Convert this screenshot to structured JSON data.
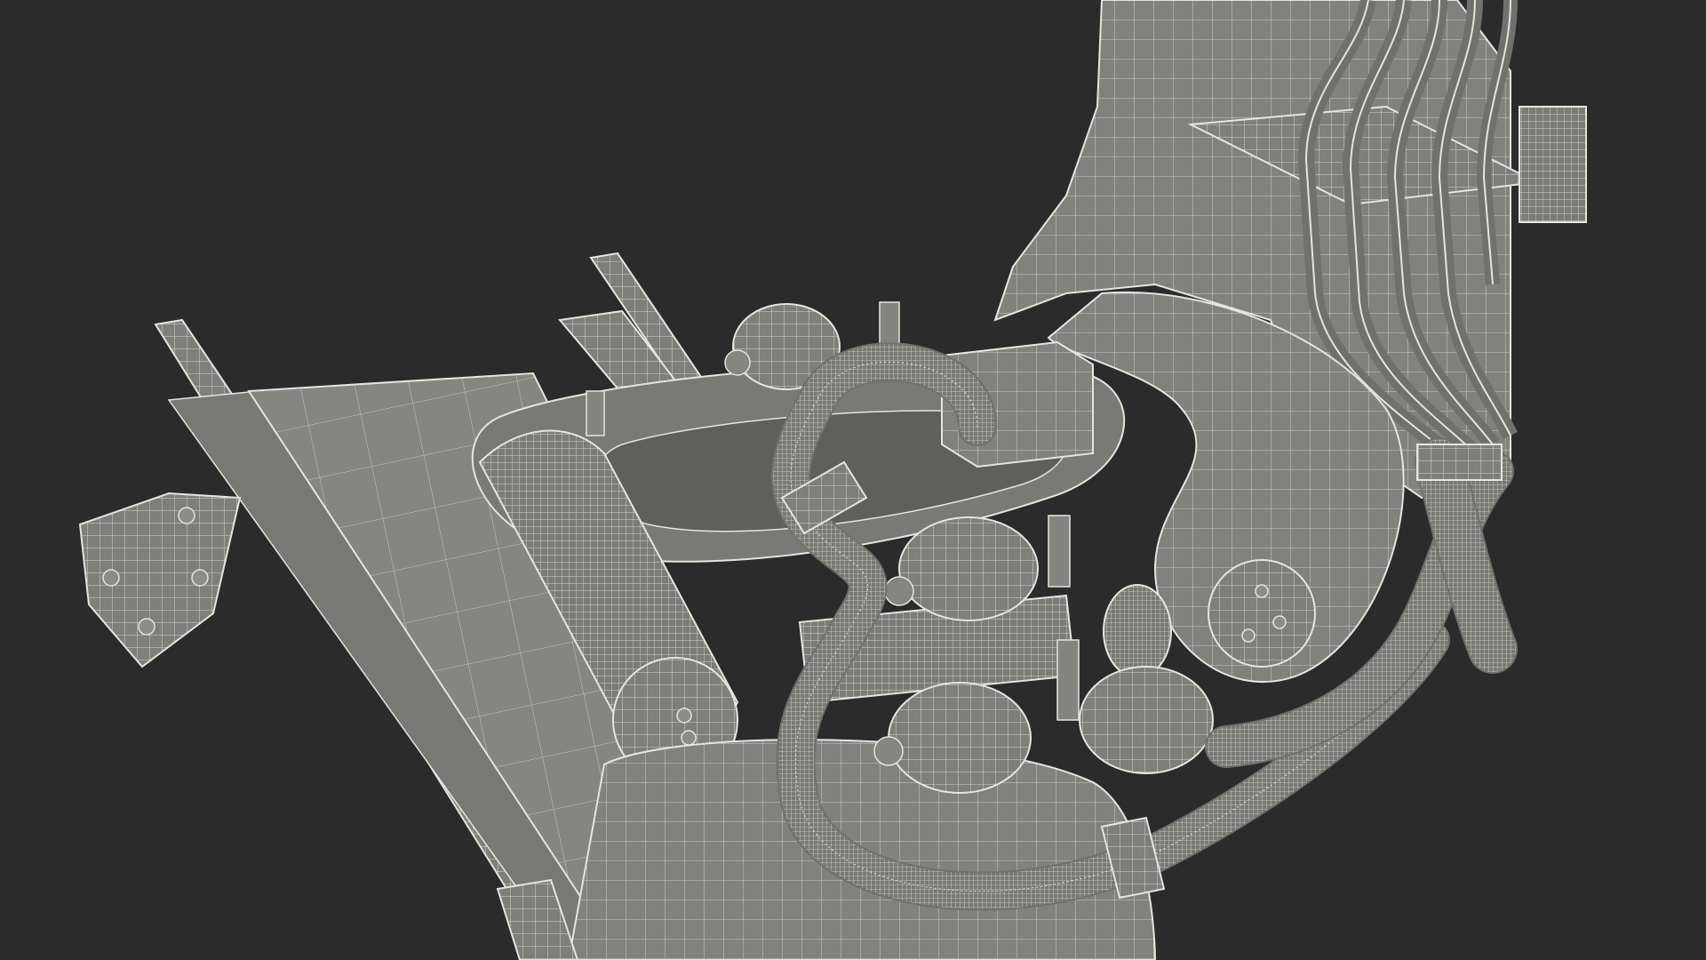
{
  "scene": {
    "background_color": "#2b2b2b",
    "model_fill_color": "#7d7f78",
    "model_shadow_color": "#5e605a",
    "wire_color": "#e6e4dc",
    "render_style": "wireframe-on-shaded",
    "subject_parts": [
      "vertical-column",
      "cable-bundle",
      "cable-mount-plate",
      "floor-rail",
      "base-plate",
      "mounting-flange",
      "bulb-upper",
      "bulb-middle",
      "bulb-lower-left",
      "bulb-lower-right",
      "junction-box",
      "corrugated-hose",
      "hose-clamp",
      "rotary-joint",
      "cylinder-housing"
    ]
  }
}
